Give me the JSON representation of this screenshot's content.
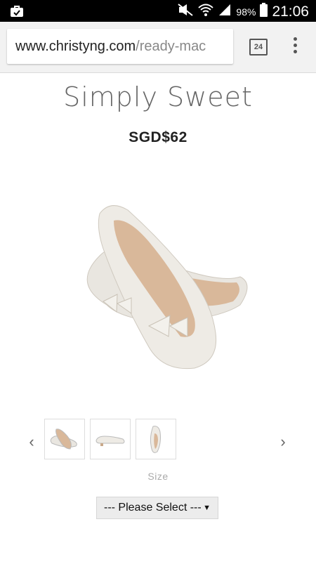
{
  "status_bar": {
    "battery_percent": "98%",
    "time": "21:06"
  },
  "browser": {
    "url_domain": "www.christyng.com",
    "url_path": "/ready-mac",
    "tab_count": "24"
  },
  "product": {
    "name": "Simply Sweet",
    "price": "SGD$62",
    "thumbnails": [
      "shoe-pair-thumb",
      "shoe-side-thumb",
      "shoe-top-thumb"
    ],
    "size_label": "Size",
    "size_select_value": "--- Please Select ---"
  },
  "colors": {
    "status_bar_bg": "#000000",
    "chrome_bg": "#f2f2f2",
    "select_bg": "#ececec"
  }
}
